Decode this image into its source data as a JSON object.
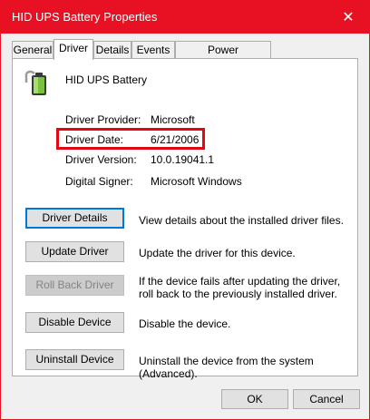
{
  "window": {
    "title": "HID UPS Battery Properties",
    "close_glyph": "✕",
    "accent": "#e81123"
  },
  "tabs": [
    {
      "label": "General"
    },
    {
      "label": "Driver"
    },
    {
      "label": "Details"
    },
    {
      "label": "Events"
    },
    {
      "label": "Power Management"
    }
  ],
  "device": {
    "name": "HID UPS Battery",
    "icon": "battery-icon"
  },
  "info": {
    "provider_label": "Driver Provider:",
    "provider_value": "Microsoft",
    "date_label": "Driver Date:",
    "date_value": "6/21/2006",
    "version_label": "Driver Version:",
    "version_value": "10.0.19041.1",
    "signer_label": "Digital Signer:",
    "signer_value": "Microsoft Windows"
  },
  "actions": [
    {
      "label": "Driver Details",
      "desc": "View details about the installed driver files."
    },
    {
      "label": "Update Driver",
      "desc": "Update the driver for this device."
    },
    {
      "label": "Roll Back Driver",
      "desc": "If the device fails after updating the driver, roll back to the previously installed driver."
    },
    {
      "label": "Disable Device",
      "desc": "Disable the device."
    },
    {
      "label": "Uninstall Device",
      "desc": "Uninstall the device from the system (Advanced)."
    }
  ],
  "footer": {
    "ok": "OK",
    "cancel": "Cancel"
  }
}
